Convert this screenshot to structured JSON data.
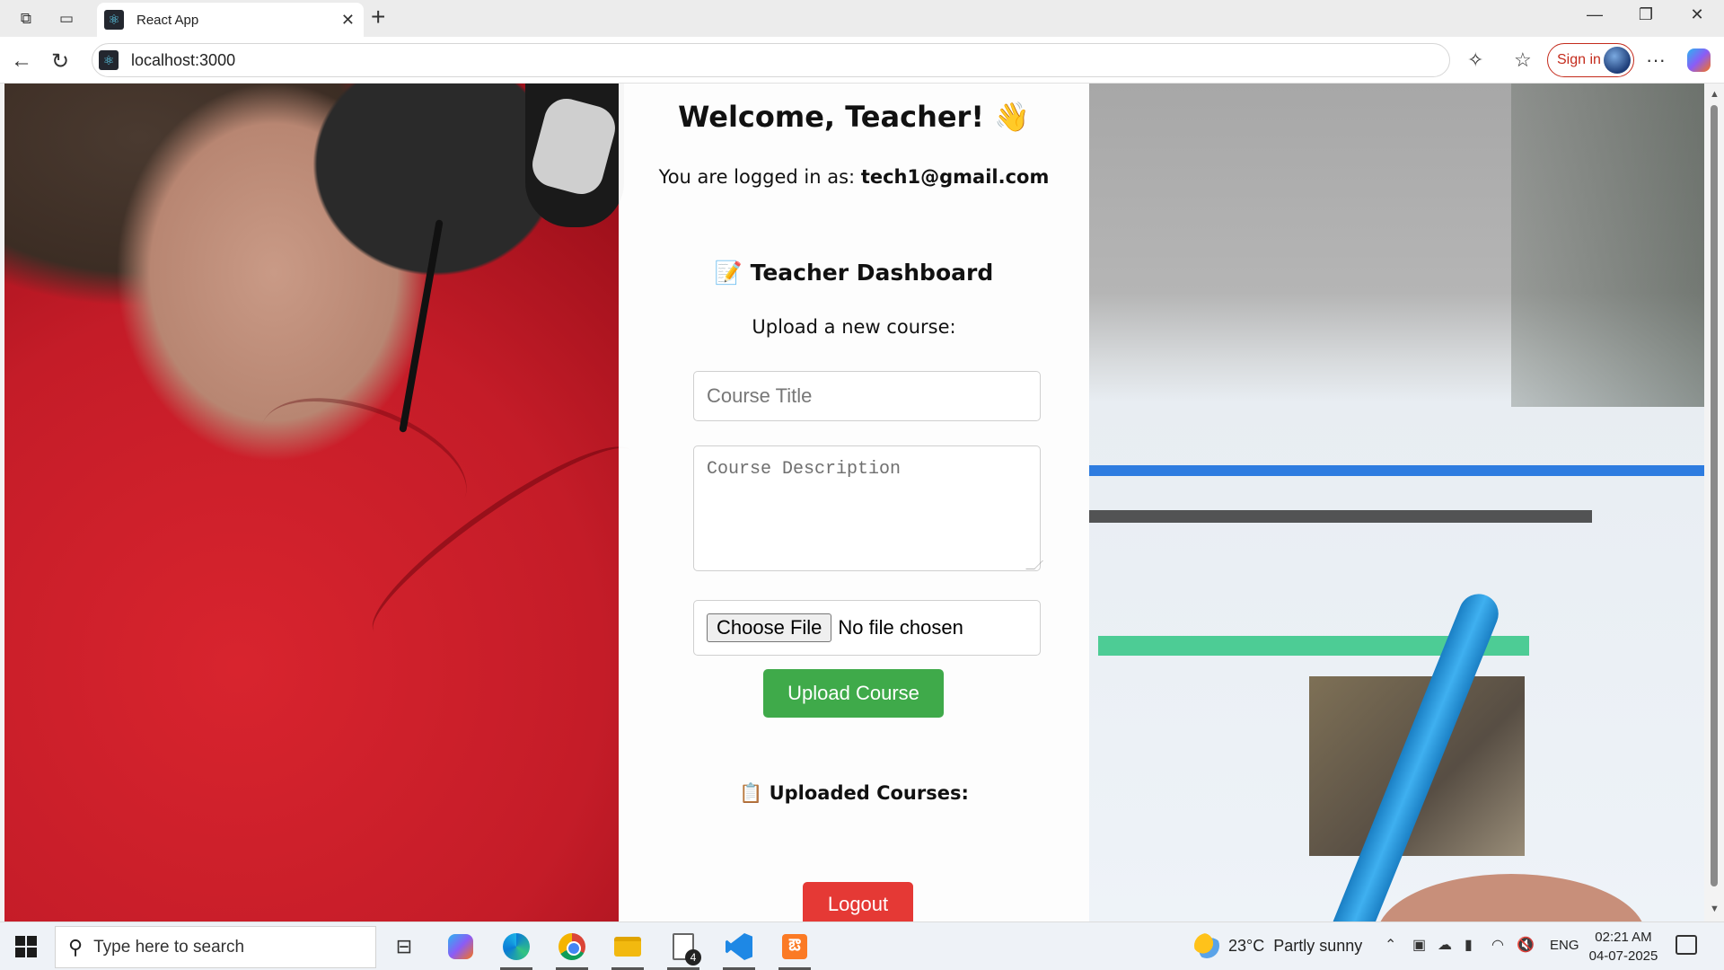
{
  "browser": {
    "tab_title": "React App",
    "tab_close": "✕",
    "new_tab": "+",
    "url": "localhost:3000",
    "sign_in": "Sign in",
    "menu": "···",
    "window": {
      "minimize": "—",
      "restore": "❐",
      "close": "✕"
    }
  },
  "page": {
    "welcome": "Welcome, Teacher! 👋",
    "logged_in_prefix": "You are logged in as: ",
    "email": "tech1@gmail.com",
    "dashboard_title": "📝 Teacher Dashboard",
    "upload_lead": "Upload a new course:",
    "course_title_placeholder": "Course Title",
    "course_desc_placeholder": "Course Description",
    "choose_file": "Choose File",
    "no_file": "No file chosen",
    "upload_button": "Upload Course",
    "uploaded_heading": "📋 Uploaded Courses:",
    "logout_button": "Logout"
  },
  "taskbar": {
    "search_placeholder": "Type here to search",
    "notes_badge": "4",
    "xampp_glyph": "ఔ",
    "temperature": "23°C",
    "weather": "Partly sunny",
    "language": "ENG",
    "time": "02:21 AM",
    "date": "04-07-2025"
  }
}
